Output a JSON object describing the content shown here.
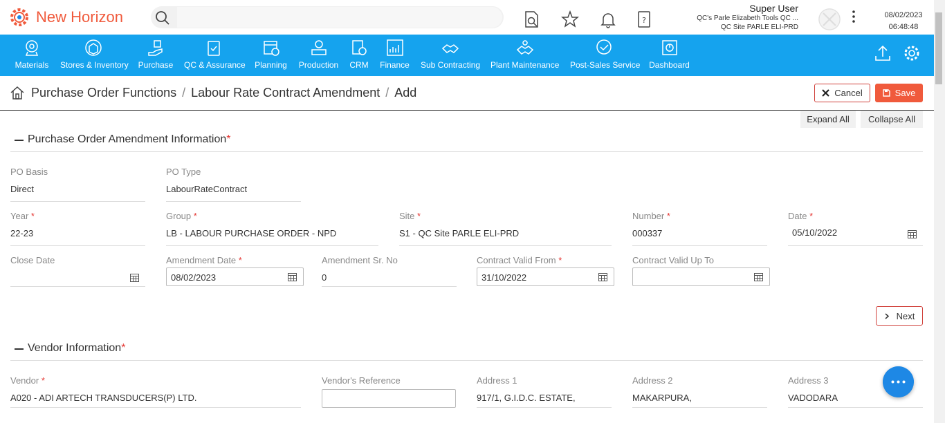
{
  "brand": {
    "name": "New Horizon",
    "color": "#f05a3c"
  },
  "search": {
    "placeholder": ""
  },
  "header_icons": [
    "document-search-icon",
    "star-icon",
    "bell-icon",
    "help-doc-icon"
  ],
  "user": {
    "name": "Super User",
    "company": "QC's Parle Elizabeth Tools QC ...",
    "site": "QC Site PARLE ELI-PRD"
  },
  "datetime": {
    "date": "08/02/2023",
    "time": "06:48:48"
  },
  "nav": {
    "color": "#15a3ee",
    "items": [
      {
        "label": "Materials",
        "icon": "materials-icon"
      },
      {
        "label": "Stores & Inventory",
        "icon": "stores-icon"
      },
      {
        "label": "Purchase",
        "icon": "purchase-icon"
      },
      {
        "label": "QC & Assurance",
        "icon": "qc-icon"
      },
      {
        "label": "Planning",
        "icon": "planning-icon"
      },
      {
        "label": "Production",
        "icon": "production-icon"
      },
      {
        "label": "CRM",
        "icon": "crm-icon"
      },
      {
        "label": "Finance",
        "icon": "finance-icon"
      },
      {
        "label": "Sub Contracting",
        "icon": "subcontracting-icon"
      },
      {
        "label": "Plant Maintenance",
        "icon": "maintenance-icon"
      },
      {
        "label": "Post-Sales Service",
        "icon": "service-icon"
      },
      {
        "label": "Dashboard",
        "icon": "dashboard-icon"
      }
    ]
  },
  "breadcrumb": [
    "Purchase Order Functions",
    "Labour Rate Contract Amendment",
    "Add"
  ],
  "actions": {
    "cancel": "Cancel",
    "save": "Save",
    "expand_all": "Expand All",
    "collapse_all": "Collapse All",
    "next": "Next"
  },
  "section1": {
    "title": "Purchase Order Amendment Information",
    "po_basis": {
      "label": "PO Basis",
      "value": "Direct"
    },
    "po_type": {
      "label": "PO Type",
      "value": "LabourRateContract"
    },
    "year": {
      "label": "Year",
      "value": "22-23"
    },
    "group": {
      "label": "Group",
      "value": "LB - LABOUR PURCHASE ORDER - NPD"
    },
    "site": {
      "label": "Site",
      "value": "S1 - QC Site PARLE ELI-PRD"
    },
    "number": {
      "label": "Number",
      "value": "000337"
    },
    "date": {
      "label": "Date",
      "value": "05/10/2022"
    },
    "close_date": {
      "label": "Close Date",
      "value": ""
    },
    "amendment_date": {
      "label": "Amendment Date",
      "value": "08/02/2023"
    },
    "amendment_sr": {
      "label": "Amendment Sr. No",
      "value": "0"
    },
    "valid_from": {
      "label": "Contract Valid From",
      "value": "31/10/2022"
    },
    "valid_upto": {
      "label": "Contract Valid Up To",
      "value": ""
    }
  },
  "section2": {
    "title": "Vendor Information",
    "vendor": {
      "label": "Vendor",
      "value": "A020 - ADI ARTECH TRANSDUCERS(P) LTD."
    },
    "vendor_ref": {
      "label": "Vendor's Reference",
      "value": ""
    },
    "address1": {
      "label": "Address 1",
      "value": "917/1, G.I.D.C. ESTATE,"
    },
    "address2": {
      "label": "Address 2",
      "value": "MAKARPURA,"
    },
    "address3": {
      "label": "Address 3",
      "value": "VADODARA"
    }
  }
}
